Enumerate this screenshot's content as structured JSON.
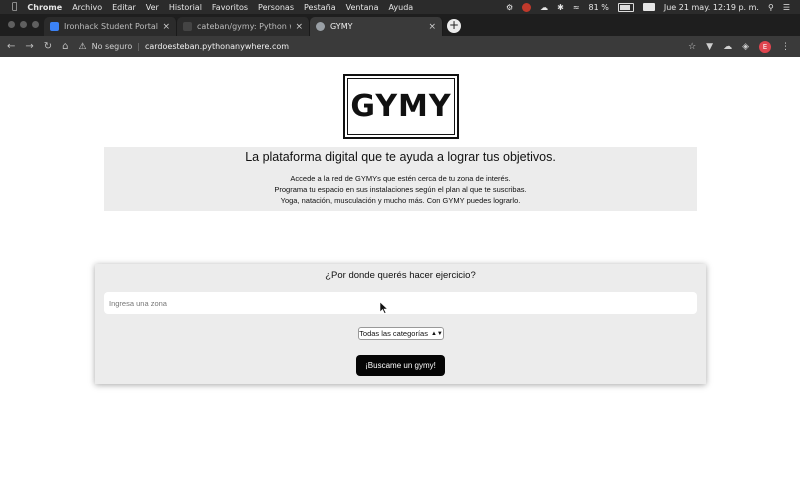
{
  "menubar": {
    "apple_icon": "apple-icon",
    "app": "Chrome",
    "menus": [
      "Archivo",
      "Editar",
      "Ver",
      "Historial",
      "Favoritos",
      "Personas",
      "Pestaña",
      "Ventana",
      "Ayuda"
    ],
    "battery": "81 %",
    "datetime": "Jue 21 may.  12:19 p. m."
  },
  "tabs": [
    {
      "title": "Ironhack Student Portal",
      "favicon_color": "#3b82f6"
    },
    {
      "title": "cateban/gymy: Python web ap",
      "favicon_color": "#444444"
    },
    {
      "title": "GYMY",
      "favicon_color": "#9aa0a6"
    }
  ],
  "toolbar": {
    "security": "No seguro",
    "url": "cardoesteban.pythonanywhere.com",
    "avatar_letter": "E"
  },
  "page": {
    "logo": "GYMY",
    "headline": "La plataforma digital que te ayuda a lograr tus objetivos.",
    "lines": [
      "Accede a la red de GYMYs que estén cerca de tu zona de interés.",
      "Programa tu espacio en sus instalaciones según el plan al que te suscribas.",
      "Yoga, natación, musculación y mucho más. Con GYMY puedes lograrlo."
    ],
    "search": {
      "question": "¿Por donde querés hacer ejercicio?",
      "zone_placeholder": "Ingresa una zona",
      "category_selected": "Todas las categorías",
      "button": "¡Buscame un gymy!"
    }
  }
}
